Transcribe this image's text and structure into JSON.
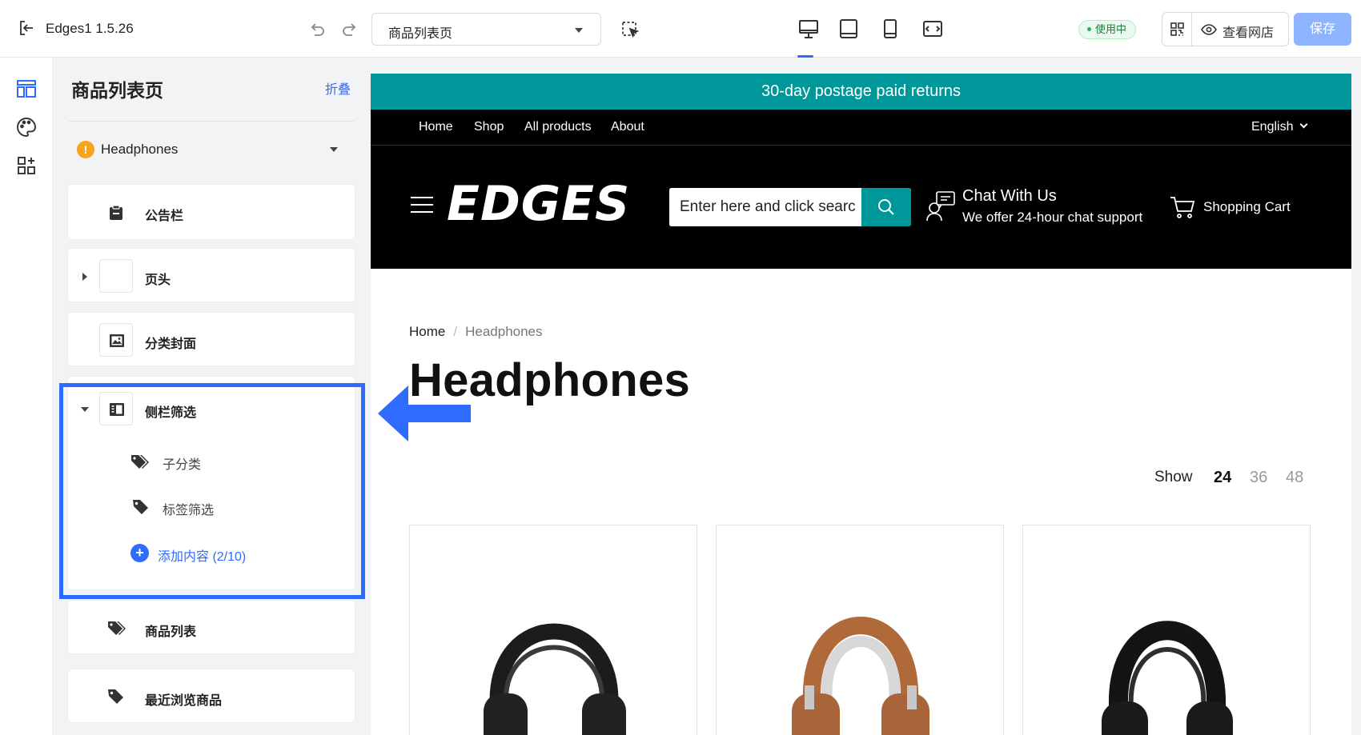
{
  "topbar": {
    "app_name": "Edges1 1.5.26",
    "page_select": "商品列表页",
    "status_badge": "使用中",
    "view_store": "查看网店",
    "save": "保存"
  },
  "panel": {
    "title": "商品列表页",
    "collapse": "折叠",
    "template": "Headphones",
    "sections": [
      {
        "label": "公告栏",
        "icon": "clipboard-icon"
      },
      {
        "label": "页头",
        "icon": "blank-icon"
      },
      {
        "label": "分类封面",
        "icon": "image-icon"
      },
      {
        "label": "侧栏筛选",
        "icon": "sidebar-icon",
        "children": [
          {
            "label": "子分类",
            "icon": "tags-icon"
          },
          {
            "label": "标签筛选",
            "icon": "tag-icon"
          }
        ],
        "add_content": "添加内容 (2/10)"
      },
      {
        "label": "商品列表",
        "icon": "tags-icon"
      },
      {
        "label": "最近浏览商品",
        "icon": "tag-icon"
      }
    ]
  },
  "store": {
    "announcement": "30-day postage paid returns",
    "nav": [
      "Home",
      "Shop",
      "All products",
      "About"
    ],
    "language": "English",
    "logo": "EDGES",
    "search_placeholder": "Enter here and click searc",
    "chat_title": "Chat With Us",
    "chat_sub": "We offer 24-hour chat support",
    "cart": "Shopping Cart",
    "breadcrumb_home": "Home",
    "breadcrumb_sep": "/",
    "breadcrumb_current": "Headphones",
    "heading": "Headphones",
    "show_label": "Show",
    "show_options": [
      "24",
      "36",
      "48"
    ],
    "accent": "#00979b"
  },
  "colors": {
    "primary": "#2f6bff",
    "save_disabled": "#8fb4ff",
    "warning": "#f7a31c"
  }
}
